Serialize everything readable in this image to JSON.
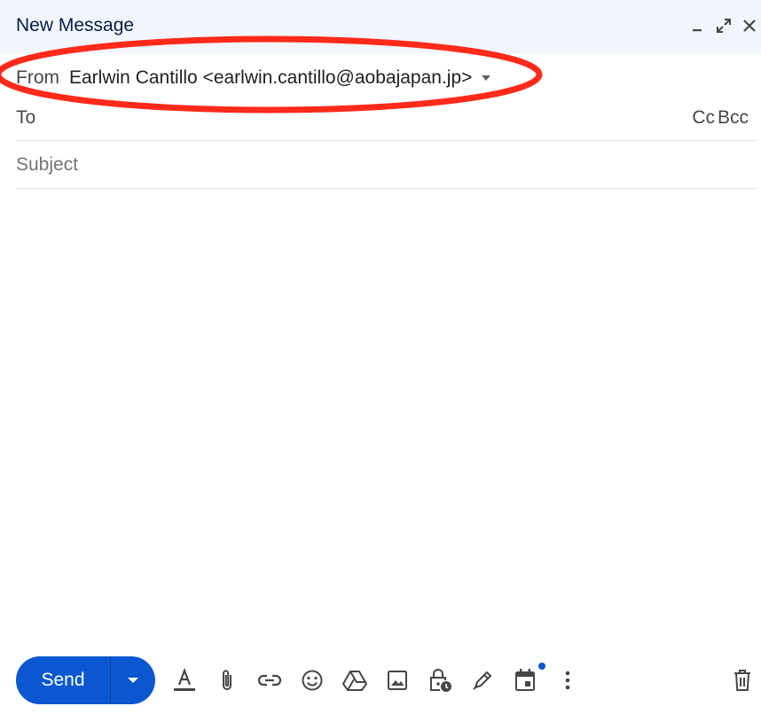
{
  "window": {
    "title": "New Message"
  },
  "from": {
    "label": "From",
    "value": "Earlwin Cantillo <earlwin.cantillo@aobajapan.jp>"
  },
  "to": {
    "label": "To",
    "cc_label": "Cc",
    "bcc_label": "Bcc"
  },
  "subject": {
    "placeholder": "Subject",
    "value": ""
  },
  "send": {
    "label": "Send"
  },
  "toolbar": {
    "icons": [
      "formatting-icon",
      "attach-icon",
      "link-icon",
      "emoji-icon",
      "drive-icon",
      "photo-icon",
      "confidential-icon",
      "signature-icon",
      "schedule-icon",
      "more-options-icon"
    ],
    "discard_icon": "trash-icon"
  },
  "colors": {
    "accent": "#0b57d0",
    "title_bar": "#f2f6fc",
    "annotation": "#ff2a1a"
  }
}
